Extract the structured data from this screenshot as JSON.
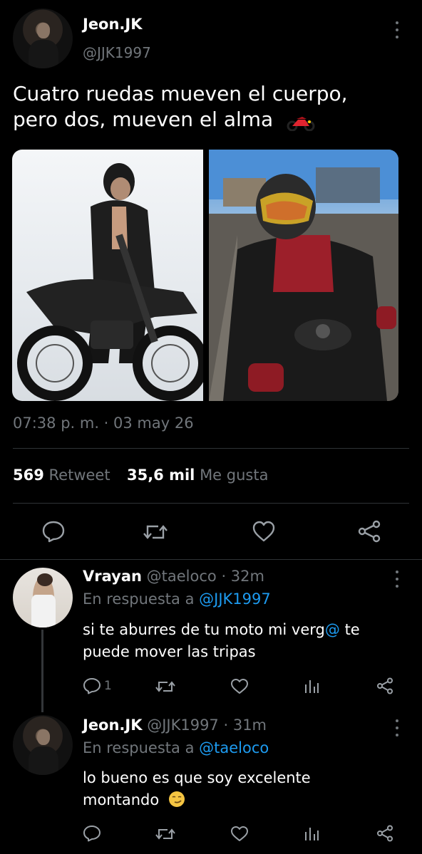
{
  "tweet": {
    "author_name": "Jeon.JK",
    "author_handle": "@JJK1997",
    "text_line1": "Cuatro ruedas mueven el cuerpo,",
    "text_line2": "pero dos, mueven el alma",
    "emoji": "motorcycle-emoji",
    "timestamp": "07:38 p. m. · 03 may 26",
    "retweet_count": "569",
    "retweet_label": "Retweet",
    "like_count": "35,6 mil",
    "like_label": "Me gusta",
    "images": [
      "photo-motorcycle-studio",
      "photo-motorcycle-road"
    ]
  },
  "actions": {
    "icons": [
      "reply-icon",
      "retweet-icon",
      "like-icon",
      "share-icon"
    ]
  },
  "replies": [
    {
      "name": "Vrayan",
      "handle": "@taeloco",
      "time": "· 32m",
      "reply_to_label": "En respuesta a",
      "reply_to_handle": "@JJK1997",
      "text_a": "si te aburres de tu moto mi verg",
      "text_at": "@",
      "text_b": " te",
      "text_line2": "puede mover las tripas",
      "reply_count": "1"
    },
    {
      "name": "Jeon.JK",
      "handle": "@JJK1997",
      "time": "· 31m",
      "reply_to_label": "En respuesta a",
      "reply_to_handle": "@taeloco",
      "text_line1": "lo bueno es que soy excelente",
      "text_line2": "montando",
      "emoji": "smirking-face-emoji"
    }
  ],
  "colors": {
    "background": "#000000",
    "text": "#e7e9ea",
    "muted": "#71767b",
    "link": "#1d9bf0",
    "divider": "#2f3336"
  }
}
